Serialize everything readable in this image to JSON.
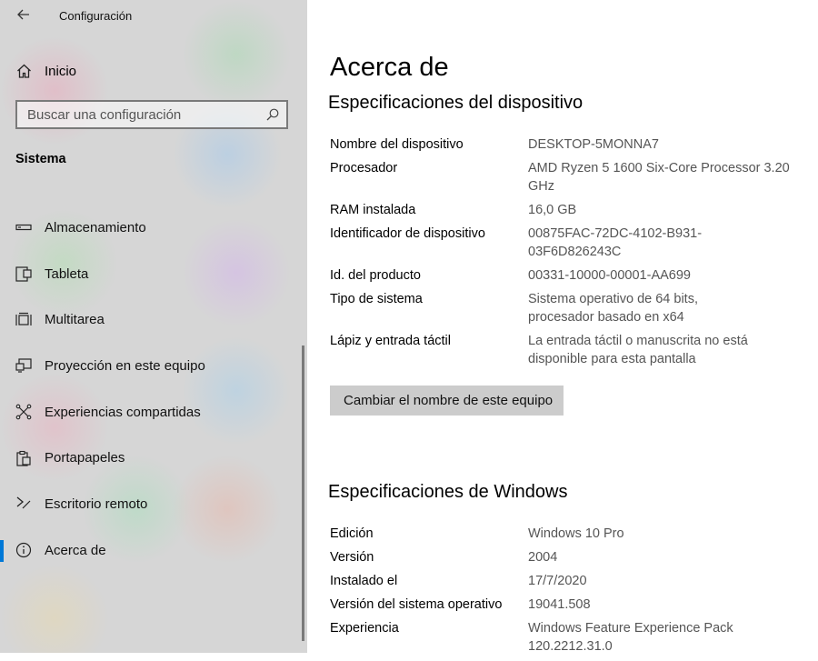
{
  "sidebar": {
    "app_title": "Configuración",
    "home_label": "Inicio",
    "search_placeholder": "Buscar una configuración",
    "section_title": "Sistema",
    "items": [
      {
        "label": "Almacenamiento",
        "icon": "storage-icon"
      },
      {
        "label": "Tableta",
        "icon": "tablet-icon"
      },
      {
        "label": "Multitarea",
        "icon": "multitasking-icon"
      },
      {
        "label": "Proyección en este equipo",
        "icon": "projecting-icon"
      },
      {
        "label": "Experiencias compartidas",
        "icon": "shared-experiences-icon"
      },
      {
        "label": "Portapapeles",
        "icon": "clipboard-icon"
      },
      {
        "label": "Escritorio remoto",
        "icon": "remote-desktop-icon"
      },
      {
        "label": "Acerca de",
        "icon": "info-icon",
        "selected": true
      }
    ]
  },
  "main": {
    "title": "Acerca de",
    "device_specs": {
      "heading": "Especificaciones del dispositivo",
      "rows": [
        {
          "key": "Nombre del dispositivo",
          "value": "DESKTOP-5MONNA7"
        },
        {
          "key": "Procesador",
          "value": "AMD Ryzen 5 1600 Six-Core Processor 3.20 GHz"
        },
        {
          "key": "RAM instalada",
          "value": "16,0 GB"
        },
        {
          "key": "Identificador de dispositivo",
          "value": "00875FAC-72DC-4102-B931-03F6D826243C"
        },
        {
          "key": "Id. del producto",
          "value": "00331-10000-00001-AA699"
        },
        {
          "key": "Tipo de sistema",
          "value": "Sistema operativo de 64 bits, procesador basado en x64"
        },
        {
          "key": "Lápiz y entrada táctil",
          "value": "La entrada táctil o manuscrita no está disponible para esta pantalla"
        }
      ],
      "rename_button": "Cambiar el nombre de este equipo"
    },
    "windows_specs": {
      "heading": "Especificaciones de Windows",
      "rows": [
        {
          "key": "Edición",
          "value": "Windows 10 Pro"
        },
        {
          "key": "Versión",
          "value": "2004"
        },
        {
          "key": "Instalado el",
          "value": "17/7/2020"
        },
        {
          "key": "Versión del sistema operativo",
          "value": "19041.508"
        },
        {
          "key": "Experiencia",
          "value": "Windows Feature Experience Pack 120.2212.31.0"
        }
      ]
    }
  },
  "colors": {
    "accent": "#0078d7",
    "sidebar_bg": "#d6d6d6",
    "button_bg": "#cccccc"
  }
}
